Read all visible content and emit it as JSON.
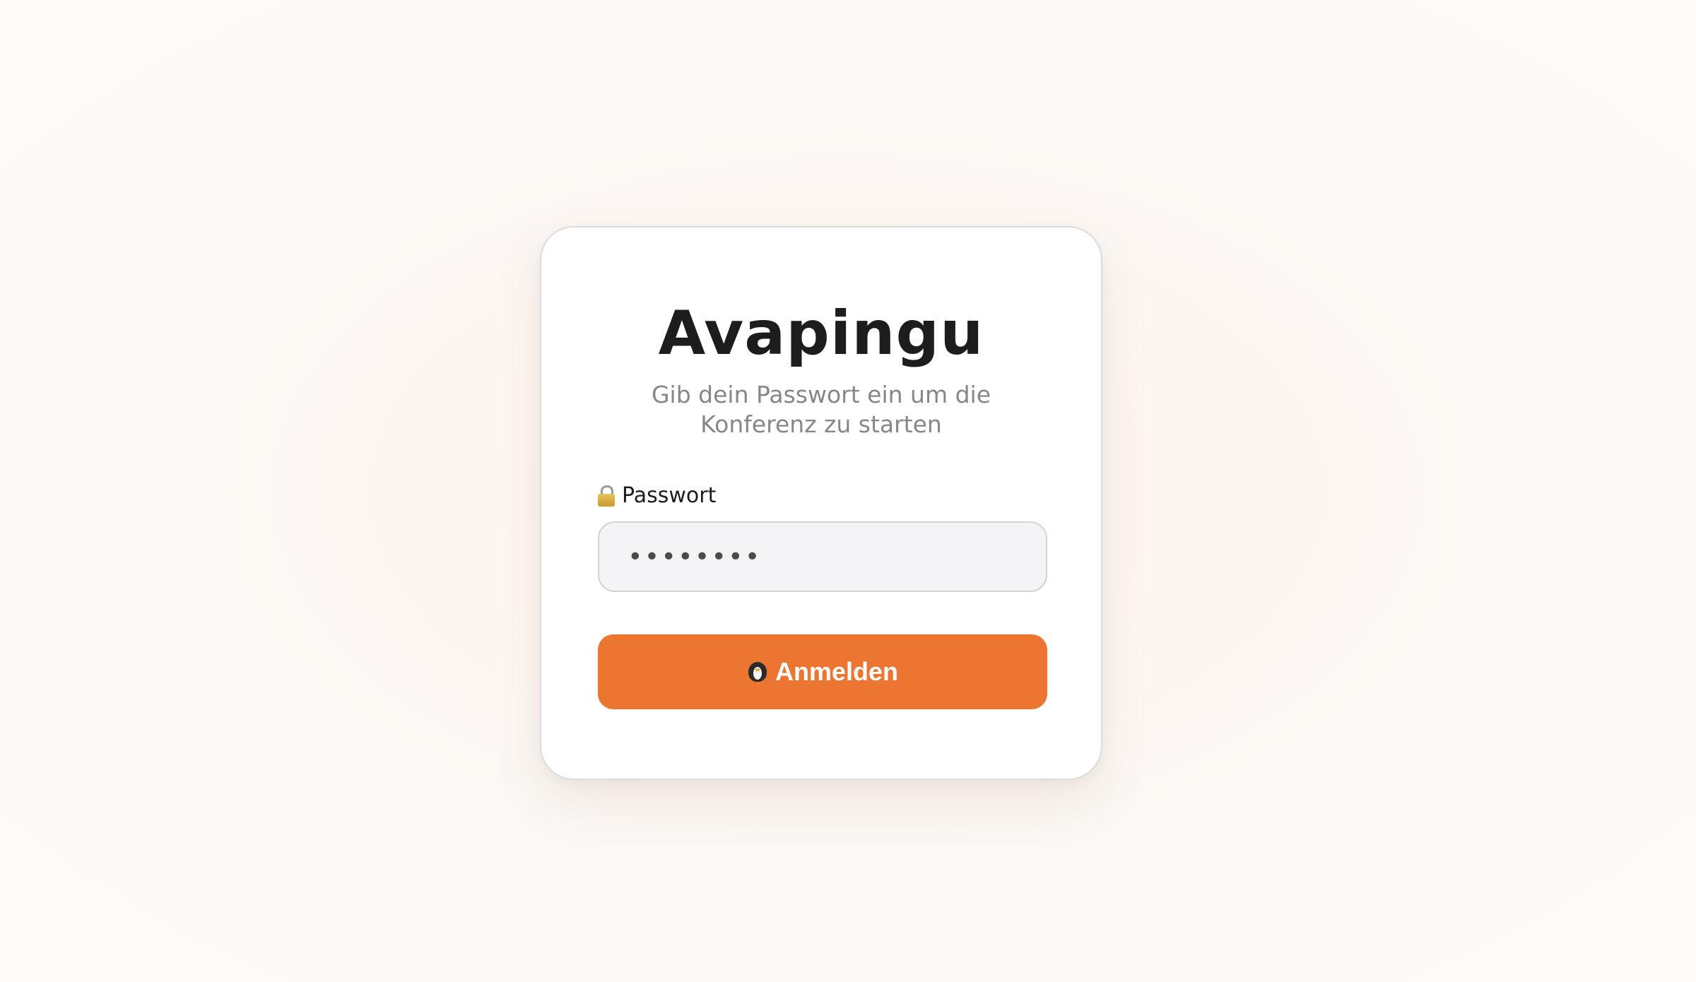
{
  "login": {
    "title": "Avapingu",
    "subtitle": "Gib dein Passwort ein um die Konferenz zu starten",
    "password_label": "Passwort",
    "password_icon": "lock-icon",
    "password_value": "password",
    "submit_label": "Anmelden",
    "submit_icon": "penguin-icon"
  },
  "colors": {
    "accent": "#ed7532",
    "title": "#1d1d1f",
    "subtitle": "#86868b",
    "input_bg": "#f4f4f7"
  }
}
